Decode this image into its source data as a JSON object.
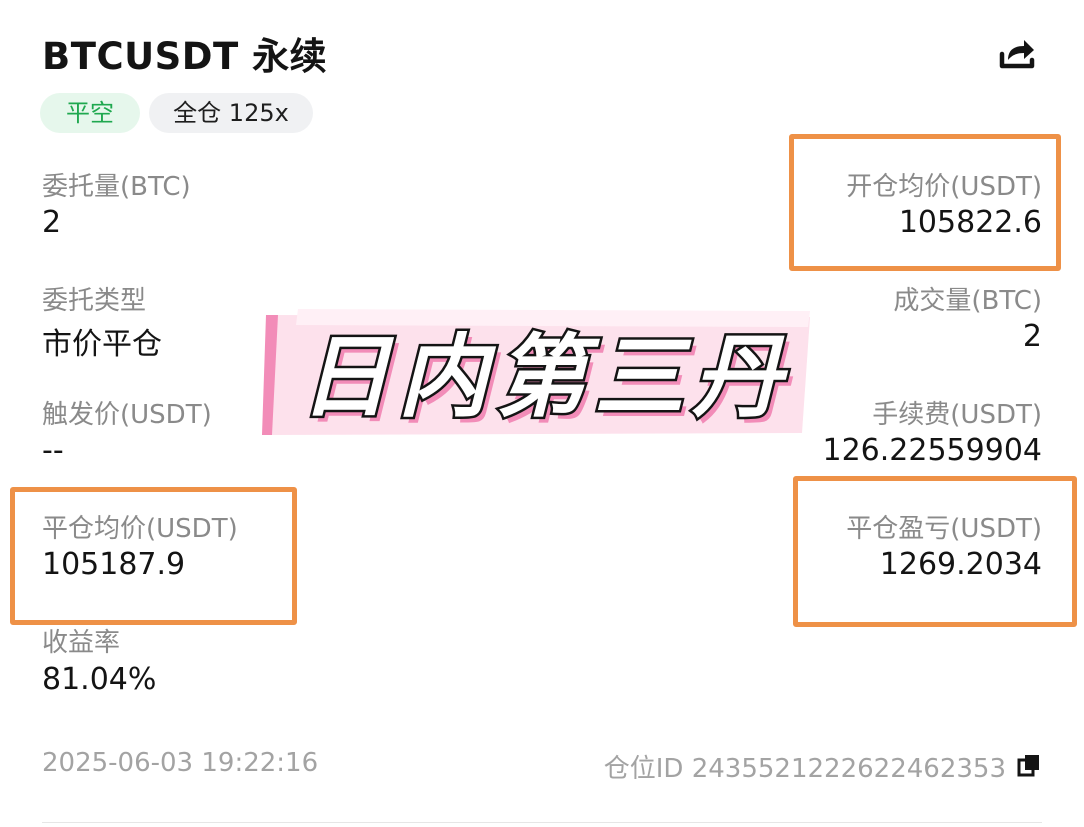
{
  "header": {
    "title": "BTCUSDT 永续",
    "share_icon": "share-icon"
  },
  "tags": {
    "side": "平空",
    "margin": "全仓 125x"
  },
  "fields": {
    "order_qty_label": "委托量(BTC)",
    "order_qty_value": "2",
    "open_avg_label": "开仓均价(USDT)",
    "open_avg_value": "105822.6",
    "order_type_label": "委托类型",
    "order_type_value": "市价平仓",
    "filled_qty_label": "成交量(BTC)",
    "filled_qty_value": "2",
    "trigger_label": "触发价(USDT)",
    "trigger_value": "--",
    "fee_label": "手续费(USDT)",
    "fee_value": "126.22559904",
    "close_avg_label": "平仓均价(USDT)",
    "close_avg_value": "105187.9",
    "close_pnl_label": "平仓盈亏(USDT)",
    "close_pnl_value": "1269.2034",
    "roi_label": "收益率",
    "roi_value": "81.04%"
  },
  "footer": {
    "time": "2025-06-03 19:22:16",
    "position_id": "仓位ID 2435521222622462353",
    "copy_icon": "copy-icon"
  },
  "overlay": {
    "banner_text": "日内第三丹"
  },
  "colors": {
    "highlight": "#ee9147",
    "side_tag_text": "#1fa84f",
    "side_tag_bg": "#e6f7ec",
    "banner_pink": "#f28cb8"
  }
}
